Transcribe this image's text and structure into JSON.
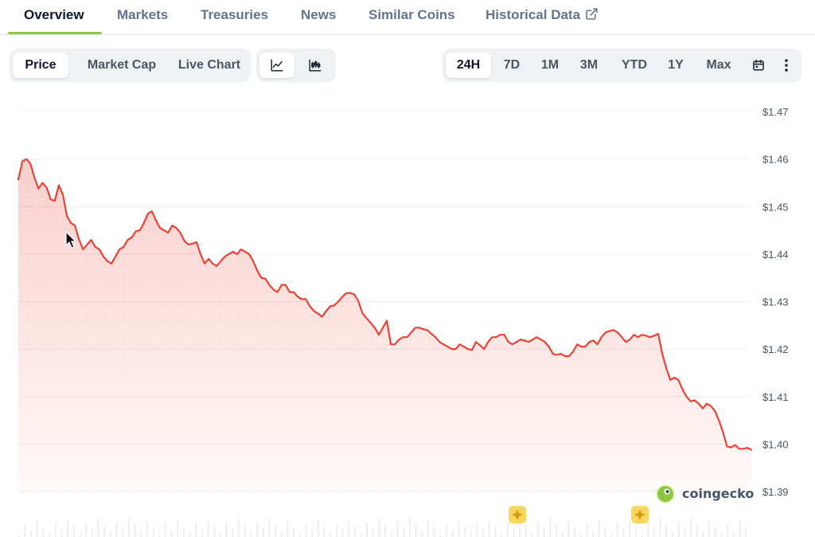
{
  "tabs": [
    {
      "label": "Overview",
      "active": true
    },
    {
      "label": "Markets"
    },
    {
      "label": "Treasuries"
    },
    {
      "label": "News"
    },
    {
      "label": "Similar Coins"
    },
    {
      "label": "Historical Data",
      "icon": "external-link-icon"
    }
  ],
  "view_toggle": [
    {
      "label": "Price",
      "active": true
    },
    {
      "label": "Market Cap"
    },
    {
      "label": "Live Chart"
    }
  ],
  "chart_style": [
    {
      "icon": "line-chart-icon",
      "active": true
    },
    {
      "icon": "candlestick-icon"
    }
  ],
  "ranges": [
    {
      "label": "24H",
      "active": true
    },
    {
      "label": "7D"
    },
    {
      "label": "1M"
    },
    {
      "label": "3M"
    },
    {
      "label": "YTD"
    },
    {
      "label": "1Y"
    },
    {
      "label": "Max"
    }
  ],
  "range_icons": [
    "calendar-icon",
    "more-vertical-icon"
  ],
  "watermark": {
    "text": "coingecko",
    "icon": "gecko-logo-icon"
  },
  "event_markers": [
    {
      "icon": "sparkle-icon"
    },
    {
      "icon": "sparkle-icon"
    }
  ],
  "colors": {
    "line": "#ea4335",
    "accent": "#8dc63f",
    "marker": "#f9d65c"
  },
  "chart_data": {
    "type": "area",
    "title": "",
    "xlabel": "",
    "ylabel": "",
    "y_tick_labels": [
      "$1.47",
      "$1.46",
      "$1.45",
      "$1.44",
      "$1.43",
      "$1.42",
      "$1.41",
      "$1.40",
      "$1.39"
    ],
    "ylim": [
      1.39,
      1.47
    ],
    "grid": true,
    "series": [
      {
        "values": [
          1.4557,
          1.4595,
          1.46,
          1.459,
          1.456,
          1.4538,
          1.455,
          1.454,
          1.4515,
          1.4512,
          1.4545,
          1.4525,
          1.448,
          1.4465,
          1.446,
          1.443,
          1.441,
          1.442,
          1.443,
          1.4415,
          1.441,
          1.4395,
          1.4385,
          1.438,
          1.4395,
          1.441,
          1.4415,
          1.443,
          1.4435,
          1.4448,
          1.445,
          1.4465,
          1.4485,
          1.449,
          1.447,
          1.4455,
          1.445,
          1.4445,
          1.446,
          1.4455,
          1.4445,
          1.4428,
          1.442,
          1.4422,
          1.4425,
          1.44,
          1.438,
          1.439,
          1.438,
          1.4375,
          1.4385,
          1.4395,
          1.44,
          1.4405,
          1.44,
          1.441,
          1.4405,
          1.44,
          1.4385,
          1.4365,
          1.435,
          1.4348,
          1.4335,
          1.4325,
          1.432,
          1.4335,
          1.4335,
          1.432,
          1.432,
          1.431,
          1.4305,
          1.4305,
          1.429,
          1.428,
          1.4275,
          1.4268,
          1.428,
          1.429,
          1.4292,
          1.43,
          1.431,
          1.4318,
          1.4318,
          1.4315,
          1.43,
          1.4275,
          1.4265,
          1.4255,
          1.4245,
          1.423,
          1.4245,
          1.426,
          1.421,
          1.421,
          1.422,
          1.4225,
          1.4225,
          1.4235,
          1.4245,
          1.4245,
          1.4242,
          1.424,
          1.4232,
          1.4225,
          1.4215,
          1.421,
          1.4205,
          1.42,
          1.42,
          1.421,
          1.4205,
          1.42,
          1.4198,
          1.4215,
          1.4208,
          1.42,
          1.4215,
          1.4225,
          1.4225,
          1.423,
          1.423,
          1.4215,
          1.421,
          1.4215,
          1.422,
          1.4218,
          1.4215,
          1.422,
          1.4225,
          1.422,
          1.4215,
          1.4205,
          1.419,
          1.4188,
          1.419,
          1.4185,
          1.4185,
          1.4195,
          1.421,
          1.4205,
          1.4205,
          1.4215,
          1.4218,
          1.421,
          1.4225,
          1.4235,
          1.4238,
          1.424,
          1.4235,
          1.4225,
          1.4215,
          1.422,
          1.423,
          1.4225,
          1.423,
          1.4228,
          1.4225,
          1.4228,
          1.4232,
          1.419,
          1.416,
          1.4135,
          1.414,
          1.4135,
          1.4115,
          1.41,
          1.409,
          1.4092,
          1.4085,
          1.4075,
          1.4085,
          1.408,
          1.407,
          1.405,
          1.4025,
          1.3995,
          1.3993,
          1.3998,
          1.399,
          1.399,
          1.3992,
          1.3988
        ]
      }
    ]
  }
}
